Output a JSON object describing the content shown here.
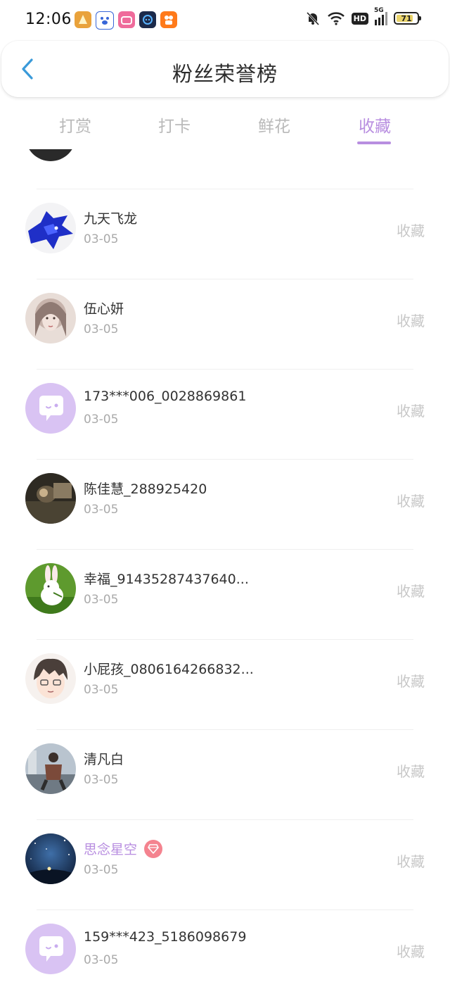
{
  "status_bar": {
    "time": "12:06",
    "network_label": "5G",
    "hd_label": "HD",
    "battery_level": "71"
  },
  "header": {
    "title": "粉丝荣誉榜"
  },
  "tabs": [
    {
      "label": "打赏",
      "active": false
    },
    {
      "label": "打卡",
      "active": false
    },
    {
      "label": "鲜花",
      "active": false
    },
    {
      "label": "收藏",
      "active": true
    }
  ],
  "list": {
    "action_label": "收藏",
    "rows": [
      {
        "name": "九天飞龙",
        "date": "03-05",
        "avatar": "blue-dragon-avatar"
      },
      {
        "name": "伍心妍",
        "date": "03-05",
        "avatar": "girl-drawing-avatar"
      },
      {
        "name": "173***006_0028869861",
        "date": "03-05",
        "avatar": "default-chat-avatar"
      },
      {
        "name": "陈佳慧_288925420",
        "date": "03-05",
        "avatar": "dark-photo-avatar"
      },
      {
        "name": "幸福_91435287437640...",
        "date": "03-05",
        "avatar": "rabbit-avatar"
      },
      {
        "name": "小屁孩_0806164266832...",
        "date": "03-05",
        "avatar": "cartoon-boy-avatar"
      },
      {
        "name": "清凡白",
        "date": "03-05",
        "avatar": "street-photo-avatar"
      },
      {
        "name": "思念星空",
        "date": "03-05",
        "avatar": "starry-sky-avatar",
        "vip": true
      },
      {
        "name": "159***423_5186098679",
        "date": "03-05",
        "avatar": "default-chat-avatar"
      }
    ]
  },
  "colors": {
    "accent": "#b88ee0",
    "back_arrow": "#3a9ad9",
    "vip_badge": "#f4838f",
    "muted_text": "#aaaaaa",
    "action_text": "#c7c7c7"
  }
}
